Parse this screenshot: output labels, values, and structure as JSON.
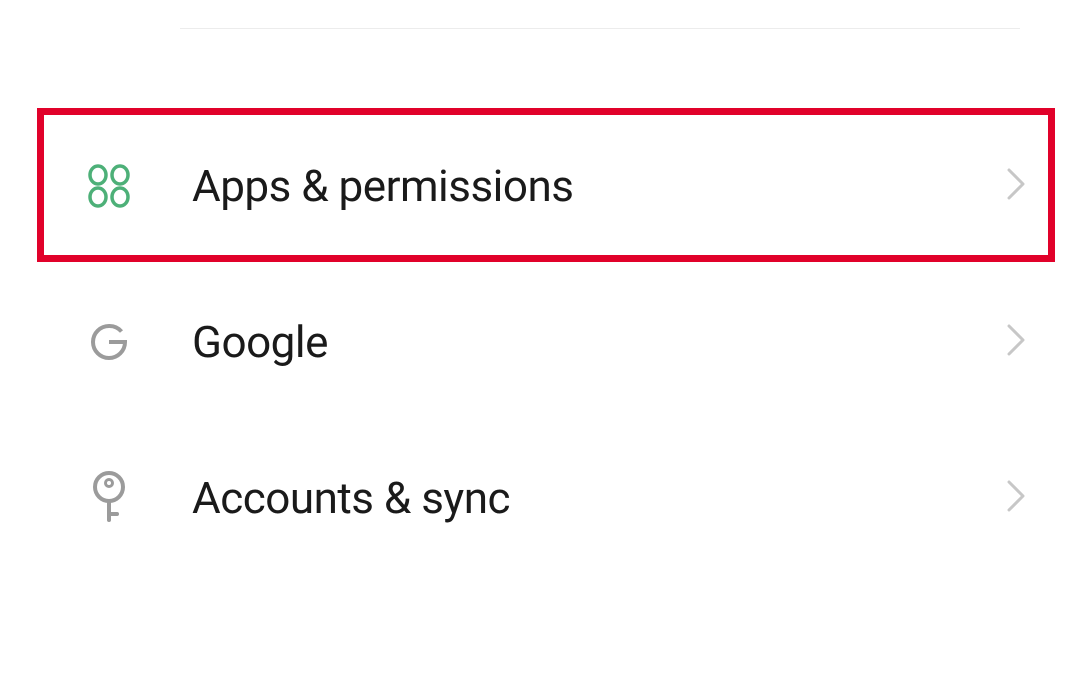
{
  "settings": {
    "items": [
      {
        "label": "Apps & permissions",
        "icon": "apps",
        "highlighted": true
      },
      {
        "label": "Google",
        "icon": "google",
        "highlighted": false
      },
      {
        "label": "Accounts & sync",
        "icon": "key",
        "highlighted": false
      }
    ]
  },
  "colors": {
    "apps_icon": "#4db078",
    "muted_icon": "#9b9b9b",
    "chevron": "#c7c7c7",
    "highlight": "#e1012a"
  }
}
